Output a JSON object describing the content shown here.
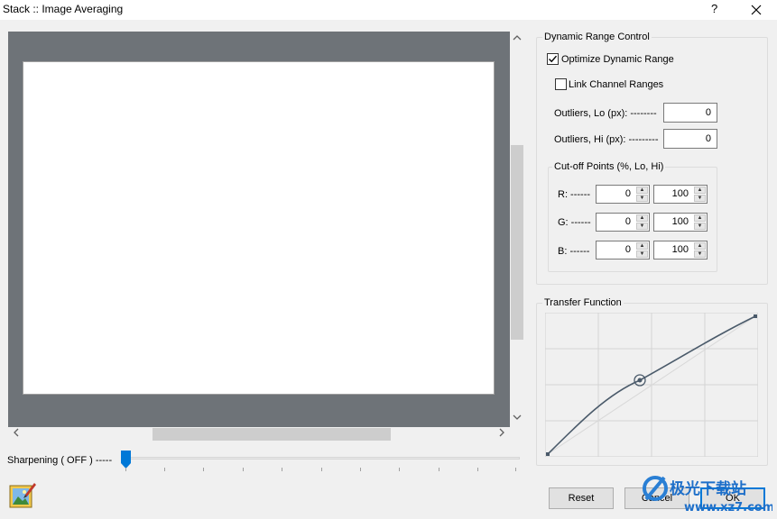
{
  "window": {
    "title": "Stack :: Image Averaging",
    "help_label": "?",
    "close_icon": "close-icon"
  },
  "preview": {
    "canvas_color": "#ffffff",
    "background_color": "#6e7378"
  },
  "sharpening": {
    "label": "Sharpening ( OFF ) -----",
    "value": 0
  },
  "dynamic_range": {
    "title": "Dynamic Range Control",
    "optimize_label": "Optimize Dynamic Range",
    "optimize_checked": true,
    "link_label": "Link Channel Ranges",
    "link_checked": false,
    "outliers_lo_label": "Outliers, Lo (px): --------",
    "outliers_lo_value": "0",
    "outliers_hi_label": "Outliers, Hi (px): ---------",
    "outliers_hi_value": "0",
    "cutoff": {
      "title": "Cut-off Points (%, Lo, Hi)",
      "rows": [
        {
          "label": "R: ------",
          "lo": "0",
          "hi": "100"
        },
        {
          "label": "G: ------",
          "lo": "0",
          "hi": "100"
        },
        {
          "label": "B: ------",
          "lo": "0",
          "hi": "100"
        }
      ]
    }
  },
  "transfer": {
    "title": "Transfer Function"
  },
  "buttons": {
    "reset": "Reset",
    "cancel": "Cancel",
    "ok": "OK"
  },
  "watermark": {
    "text": "极光下载站",
    "url": "www.xz7.com"
  },
  "colors": {
    "accent": "#0078d7",
    "curve": "#4a5a6a"
  }
}
